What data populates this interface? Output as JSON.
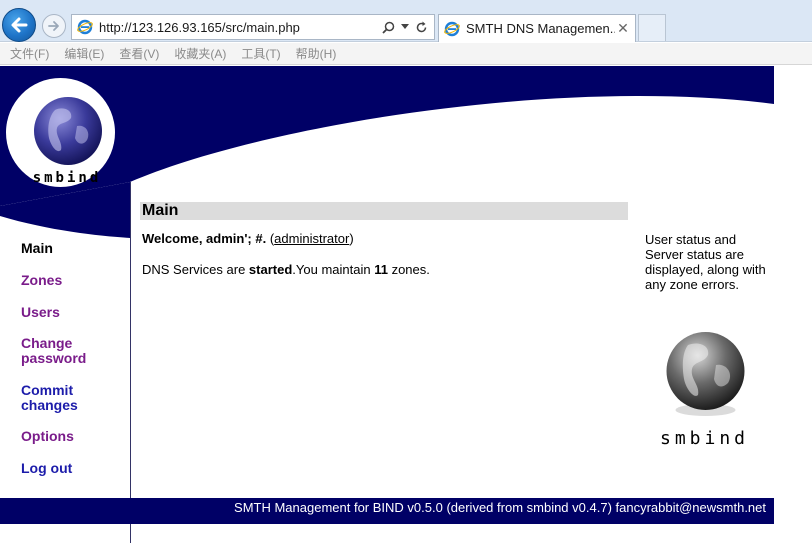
{
  "browser": {
    "url": "http://123.126.93.165/src/main.php",
    "tab_title": "SMTH DNS Managemen...",
    "menu": [
      "文件(F)",
      "编辑(E)",
      "查看(V)",
      "收藏夹(A)",
      "工具(T)",
      "帮助(H)"
    ]
  },
  "logo": {
    "text": "smbind"
  },
  "nav": {
    "main": "Main",
    "zones": "Zones",
    "users": "Users",
    "change_password_line1": "Change",
    "change_password_line2": "password",
    "commit_line1": "Commit",
    "commit_line2": "changes",
    "options": "Options",
    "logout": "Log out"
  },
  "content": {
    "heading": "Main",
    "welcome_prefix": "Welcome, admin'; #.",
    "welcome_open": " (",
    "role": "administrator",
    "welcome_close": ")",
    "status_prefix": "DNS Services are ",
    "status_state": "started",
    "status_mid": ".You maintain ",
    "zone_count": "11",
    "status_suffix": " zones."
  },
  "help": {
    "text": "User status and Server status are displayed, along with any zone errors."
  },
  "right_logo": {
    "text": "smbind"
  },
  "footer": {
    "text": "SMTH Management for BIND v0.5.0 (derived from smbind v0.4.7) fancyrabbit@newsmth.net"
  },
  "colors": {
    "banner": "#000066",
    "nav_visited": "#7a1c8a",
    "nav_link": "#1c1caa"
  }
}
